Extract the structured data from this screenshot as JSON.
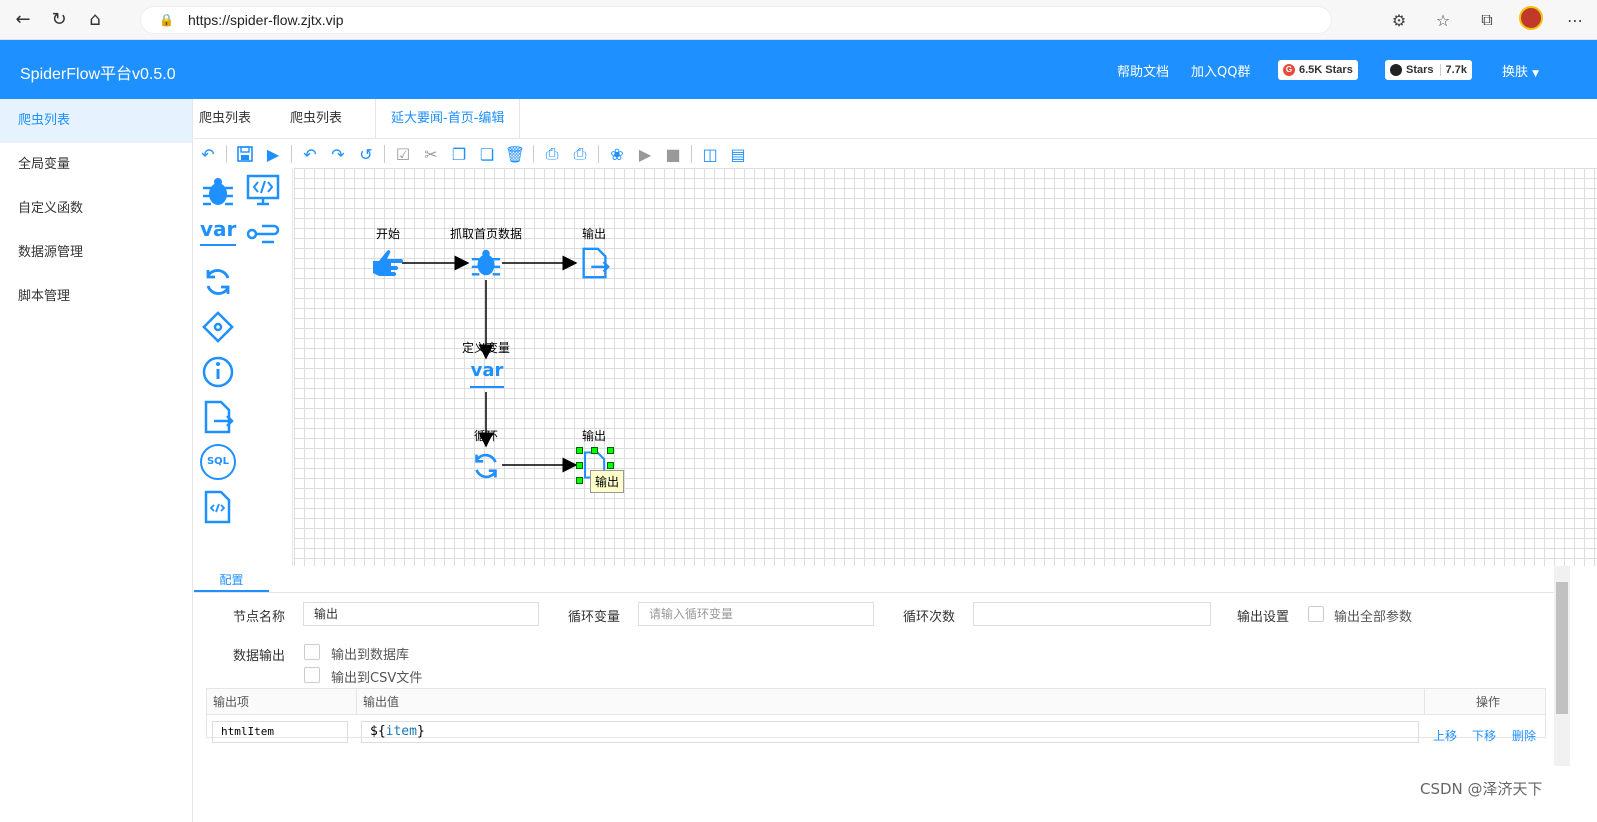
{
  "browser": {
    "url": "https://spider-flow.zjtx.vip"
  },
  "header": {
    "brand": "SpiderFlow平台v0.5.0",
    "help": "帮助文档",
    "qq": "加入QQ群",
    "gitee_stars": "6.5K Stars",
    "github_label": "Stars",
    "github_count": "7.7k",
    "skin": "换肤"
  },
  "sidebar": {
    "items": [
      {
        "label": "爬虫列表"
      },
      {
        "label": "全局变量"
      },
      {
        "label": "自定义函数"
      },
      {
        "label": "数据源管理"
      },
      {
        "label": "脚本管理"
      }
    ]
  },
  "tabs": [
    {
      "label": "爬虫列表"
    },
    {
      "label": "爬虫列表"
    },
    {
      "label": "延大要闻-首页-编辑"
    }
  ],
  "flow": {
    "nodes": [
      {
        "label": "开始"
      },
      {
        "label": "抓取首页数据"
      },
      {
        "label": "输出"
      },
      {
        "label": "定义变量"
      },
      {
        "label": "循环"
      },
      {
        "label": "输出"
      }
    ],
    "tooltip": "输出",
    "var_text": "var"
  },
  "palette": {
    "var_text": "var",
    "sql_text": "SQL"
  },
  "config": {
    "tab": "配置",
    "node_name_label": "节点名称",
    "node_name_value": "输出",
    "loop_var_label": "循环变量",
    "loop_var_placeholder": "请输入循环变量",
    "loop_count_label": "循环次数",
    "output_settings_label": "输出设置",
    "output_all_params": "输出全部参数",
    "data_output_label": "数据输出",
    "to_db": "输出到数据库",
    "to_csv": "输出到CSV文件",
    "table": {
      "col_item": "输出项",
      "col_value": "输出值",
      "col_ops": "操作",
      "row_item": "htmlItem",
      "row_value_prefix": "${",
      "row_value_var": "item",
      "row_value_suffix": "}",
      "up": "上移",
      "down": "下移",
      "delete": "删除"
    }
  },
  "watermark": "CSDN @泽济天下"
}
